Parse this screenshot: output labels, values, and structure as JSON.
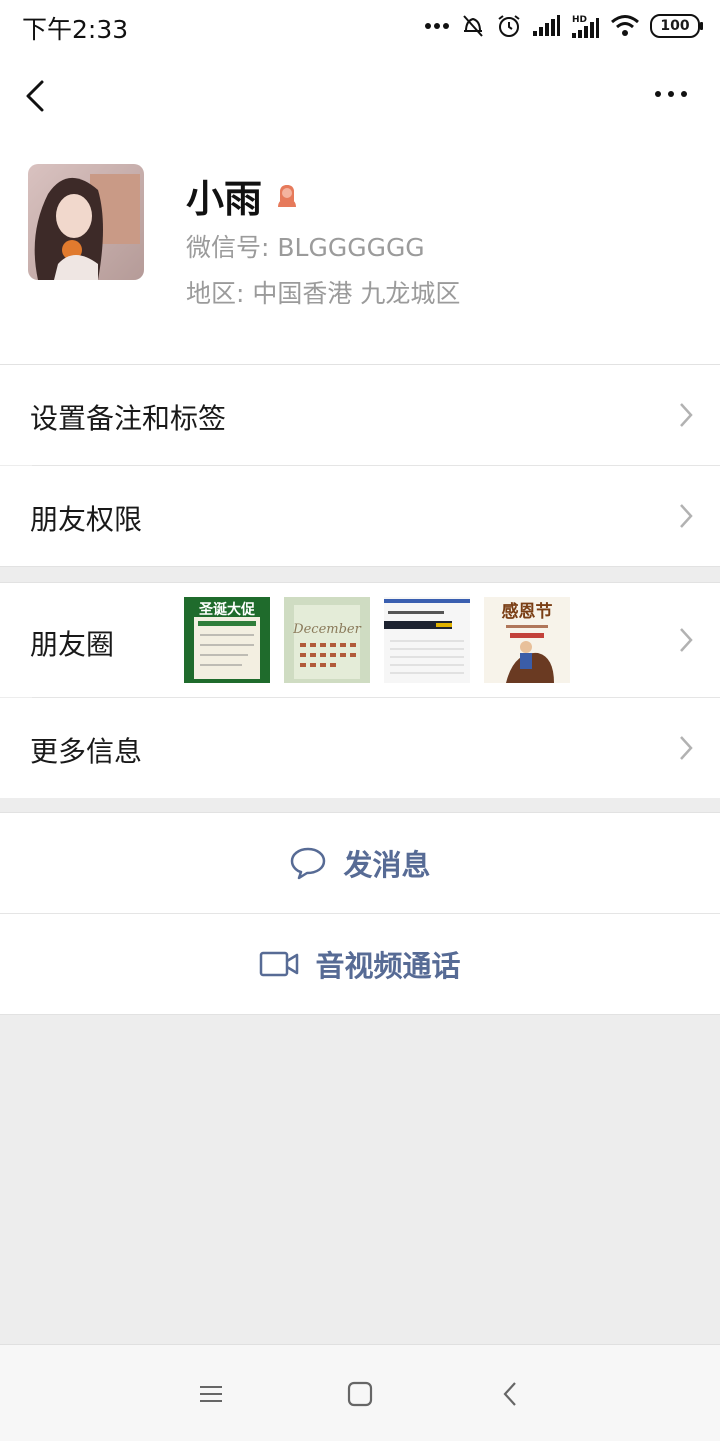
{
  "status": {
    "time": "下午2:33",
    "battery": "100",
    "icons": [
      "dots-icon",
      "mute-icon",
      "alarm-icon",
      "signal-icon",
      "hd-signal-icon",
      "wifi-icon",
      "battery-icon"
    ]
  },
  "nav": {
    "back_icon": "back-arrow-icon",
    "more_icon": "more-dots-icon"
  },
  "profile": {
    "name": "小雨",
    "gender_icon": "female-icon",
    "wechat_id": "微信号: BLGGGGGG",
    "region": "地区: 中国香港  九龙城区"
  },
  "menu": {
    "remark": "设置备注和标签",
    "permission": "朋友权限",
    "moments": "朋友圈",
    "more_info": "更多信息"
  },
  "moments_thumbs": {
    "t1_title": "圣诞大促",
    "t2_title": "December",
    "t4_title": "感恩节"
  },
  "actions": {
    "message": "发消息",
    "video_call": "音视频通话"
  },
  "colors": {
    "link": "#576b95",
    "background": "#ededed",
    "gender": "#e67a5b"
  }
}
